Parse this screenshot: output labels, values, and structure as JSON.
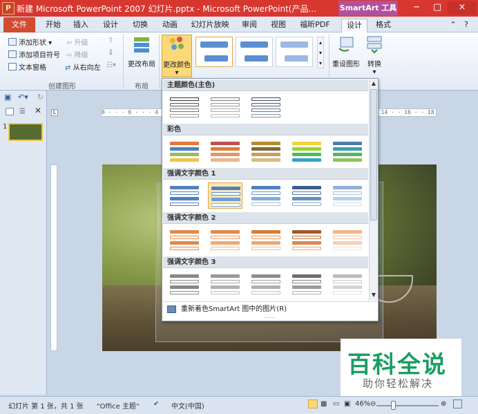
{
  "titlebar": {
    "app_icon": "P",
    "title": "新建 Microsoft PowerPoint 2007 幻灯片.pptx - Microsoft PowerPoint(产品...",
    "context_tab": "SmartArt 工具",
    "minimize": "−",
    "restore": "□",
    "close": "×"
  },
  "tabs": {
    "file": "文件",
    "items": [
      "开始",
      "插入",
      "设计",
      "切换",
      "动画",
      "幻灯片放映",
      "审阅",
      "视图",
      "福昕PDF",
      "设计",
      "格式"
    ]
  },
  "ribbon": {
    "create_graphic": {
      "add_shape": "添加形状",
      "add_bullet": "添加项目符号",
      "text_pane": "文本窗格",
      "promote": "升级",
      "demote": "降级",
      "right_to_left": "从右向左",
      "label": "创建图形"
    },
    "layout": {
      "change_layout": "更改布局",
      "label": "布局"
    },
    "change_colors": "更改颜色",
    "reset": {
      "reset_graphic": "重设图形",
      "convert": "转换"
    }
  },
  "dropdown": {
    "sections": [
      {
        "title": "主题颜色(主色)"
      },
      {
        "title": "彩色"
      },
      {
        "title": "强调文字颜色 1"
      },
      {
        "title": "强调文字颜色 2"
      },
      {
        "title": "强调文字颜色 3"
      }
    ],
    "recolor_pictures": "重新着色SmartArt 图中的图片(R)"
  },
  "slide_panel": {
    "slide_number": "1"
  },
  "ruler": {
    "marks": "8 · · · 6 · · · 4 · · · 2 · · · 0 · · · 2 · · · 4 · · · 6 · · · 8 · · 10 · · 12 · · 14 · · 16 · · 18 · · 20 · · 22 · · 24 · · 26"
  },
  "watermark": {
    "title": "百科全说",
    "subtitle": "助你轻松解决"
  },
  "status": {
    "slide_info": "幻灯片 第 1 张，共 1 张",
    "theme": "\"Office 主题\"",
    "language": "中文(中国)",
    "zoom": "46%"
  },
  "colors": {
    "title_bar": "#d7372f",
    "context_tab": "#b3509c",
    "file_tab": "#d24d30",
    "selection": "#f3c54b"
  }
}
